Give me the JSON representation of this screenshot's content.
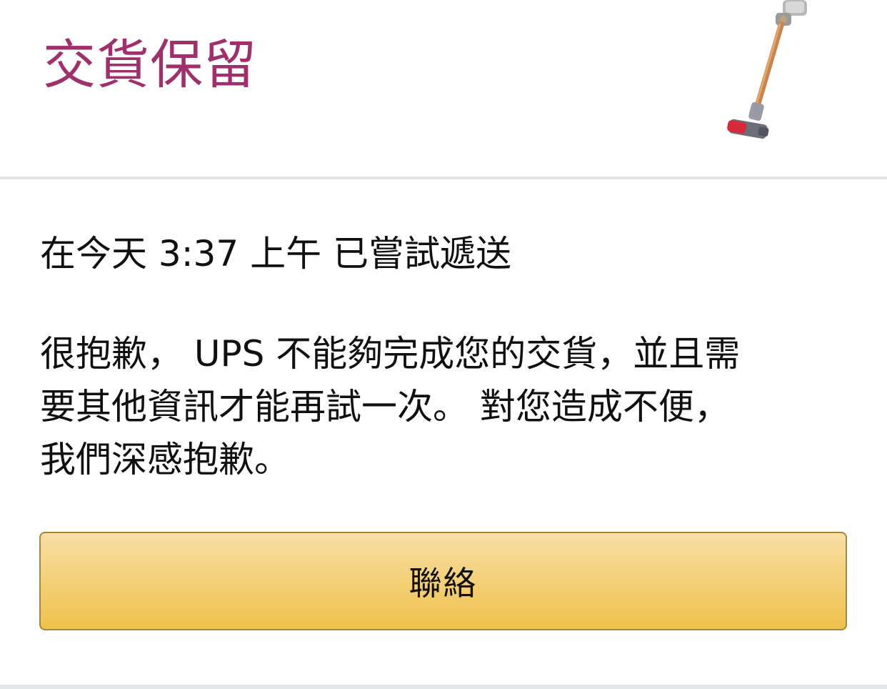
{
  "header": {
    "status_title": "交貨保留",
    "product_image": "vacuum-cleaner-icon"
  },
  "attempt": {
    "text": "在今天 3:37 上午 已嘗試遞送"
  },
  "message": {
    "line1": "很抱歉， UPS 不能夠完成您的交貨，並且需",
    "line2": "要其他資訊才能再試一次。 對您造成不便，",
    "line3": "我們深感抱歉。"
  },
  "actions": {
    "contact_label": "聯絡"
  },
  "colors": {
    "title": "#a0306b",
    "text": "#0f1111",
    "button_top": "#f7dfa5",
    "button_bottom": "#f0c14b",
    "button_border": "#a88734"
  }
}
